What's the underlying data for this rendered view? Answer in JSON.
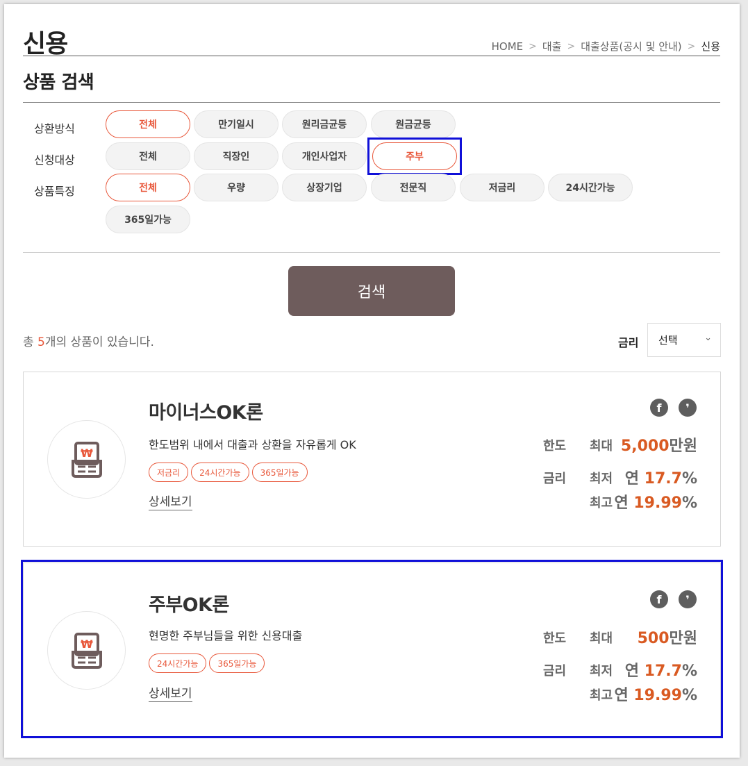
{
  "header": {
    "title": "신용",
    "breadcrumb": [
      "HOME",
      "대출",
      "대출상품(공시 및 안내)",
      "신용"
    ]
  },
  "search_section": {
    "title": "상품 검색",
    "filters": [
      {
        "label": "상환방식",
        "options": [
          "전체",
          "만기일시",
          "원리금균등",
          "원금균등"
        ],
        "selected": "전체"
      },
      {
        "label": "신청대상",
        "options": [
          "전체",
          "직장인",
          "개인사업자",
          "주부"
        ],
        "selected": "주부"
      },
      {
        "label": "상품특징",
        "options": [
          "전체",
          "우량",
          "상장기업",
          "전문직",
          "저금리",
          "24시간가능",
          "365일가능"
        ],
        "selected": "전체"
      }
    ],
    "search_button": "검색"
  },
  "results": {
    "count_prefix": "총 ",
    "count": "5",
    "count_suffix": "개의 상품이 있습니다.",
    "sort_label": "금리",
    "sort_value": "선택"
  },
  "products": [
    {
      "name": "마이너스OK론",
      "description": "한도범위 내에서 대출과 상환을 자유롭게 OK",
      "tags": [
        "저금리",
        "24시간가능",
        "365일가능"
      ],
      "detail_link": "상세보기",
      "limit_label": "한도",
      "limit_prefix": "최대",
      "limit_value": "5,000",
      "limit_unit": "만원",
      "rate_label": "금리",
      "rate_min_prefix": "최저",
      "rate_min_year": "연",
      "rate_min": "17.7",
      "rate_max_prefix": "최고",
      "rate_max_year": "연",
      "rate_max": "19.99",
      "percent": "%"
    },
    {
      "name": "주부OK론",
      "description": "현명한 주부님들을 위한 신용대출",
      "tags": [
        "24시간가능",
        "365일가능"
      ],
      "detail_link": "상세보기",
      "limit_label": "한도",
      "limit_prefix": "최대",
      "limit_value": "500",
      "limit_unit": "만원",
      "rate_label": "금리",
      "rate_min_prefix": "최저",
      "rate_min_year": "연",
      "rate_min": "17.7",
      "rate_max_prefix": "최고",
      "rate_max_year": "연",
      "rate_max": "19.99",
      "percent": "%"
    }
  ],
  "icons": {
    "facebook": "f",
    "kakao": "❜"
  },
  "colors": {
    "accent": "#e8573a",
    "search_button": "#6e5c5c",
    "highlight": "#1010d8",
    "value": "#d95a22"
  }
}
